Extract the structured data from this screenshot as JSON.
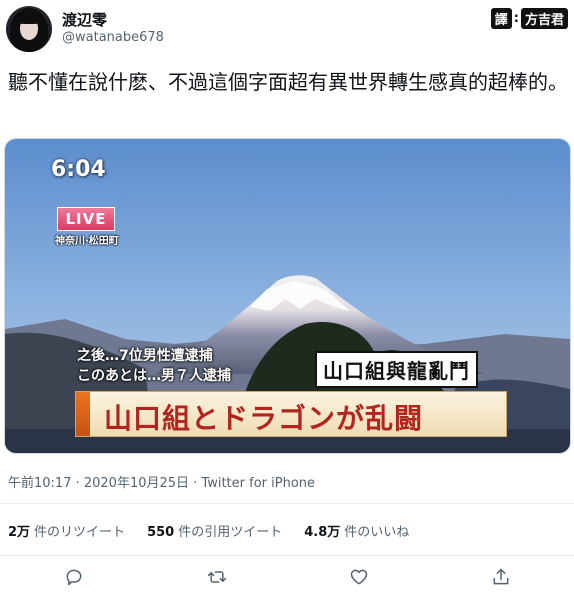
{
  "user": {
    "display_name": "渡辺零",
    "handle": "@watanabe678"
  },
  "translator_badge": {
    "label_left": "譯",
    "separator": ":",
    "label_right": "方吉君"
  },
  "tweet": {
    "text": "聽不懂在說什麽、不過這個字面超有異世界轉生感真的超棒的。"
  },
  "media": {
    "time": "6:04",
    "live_label": "LIVE",
    "live_location": "神奈川·松田町",
    "subtitle_cn": "之後…7位男性遭逮捕",
    "subtitle_jp": "このあとは…男７人逮捕",
    "translation_box": "山口組與龍亂鬥",
    "headline": "山口組とドラゴンが乱闘"
  },
  "meta": {
    "timestamp": "午前10:17 · 2020年10月25日 · Twitter for iPhone"
  },
  "stats": {
    "retweets_count": "2万",
    "retweets_label": "件のリツイート",
    "quotes_count": "550",
    "quotes_label": "件の引用ツイート",
    "likes_count": "4.8万",
    "likes_label": "件のいいね"
  },
  "actions": {
    "reply_icon": "reply-icon",
    "retweet_icon": "retweet-icon",
    "like_icon": "like-icon",
    "share_icon": "share-icon"
  },
  "colors": {
    "text_primary": "#0f1419",
    "text_secondary": "#536471",
    "sky_top": "#5f90cf",
    "headline_red": "#b0251e",
    "live_pink": "#e0567d"
  }
}
